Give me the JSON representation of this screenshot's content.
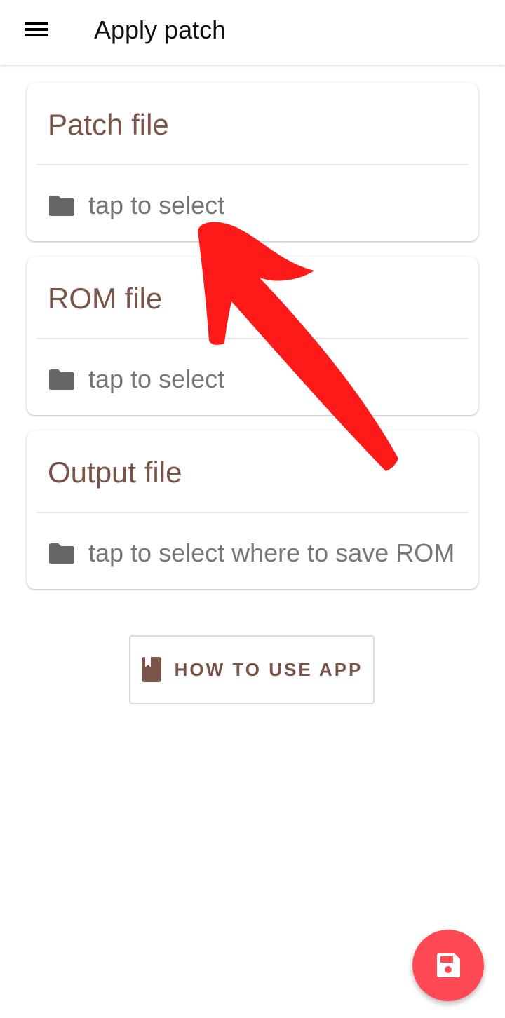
{
  "app_bar": {
    "title": "Apply patch",
    "menu_icon": "menu-icon"
  },
  "cards": [
    {
      "title": "Patch file",
      "action_text": "tap to select",
      "icon": "folder-icon"
    },
    {
      "title": "ROM file",
      "action_text": "tap to select",
      "icon": "folder-icon"
    },
    {
      "title": "Output file",
      "action_text": "tap to select where to save ROM",
      "icon": "folder-icon"
    }
  ],
  "help_button": {
    "label": "HOW TO USE APP",
    "icon": "book-icon"
  },
  "fab": {
    "icon": "save-icon"
  },
  "colors": {
    "accent": "#7a5448",
    "fab": "#ff4a55",
    "annotation_arrow": "#ff1a1a",
    "icon_gray": "#666666"
  }
}
